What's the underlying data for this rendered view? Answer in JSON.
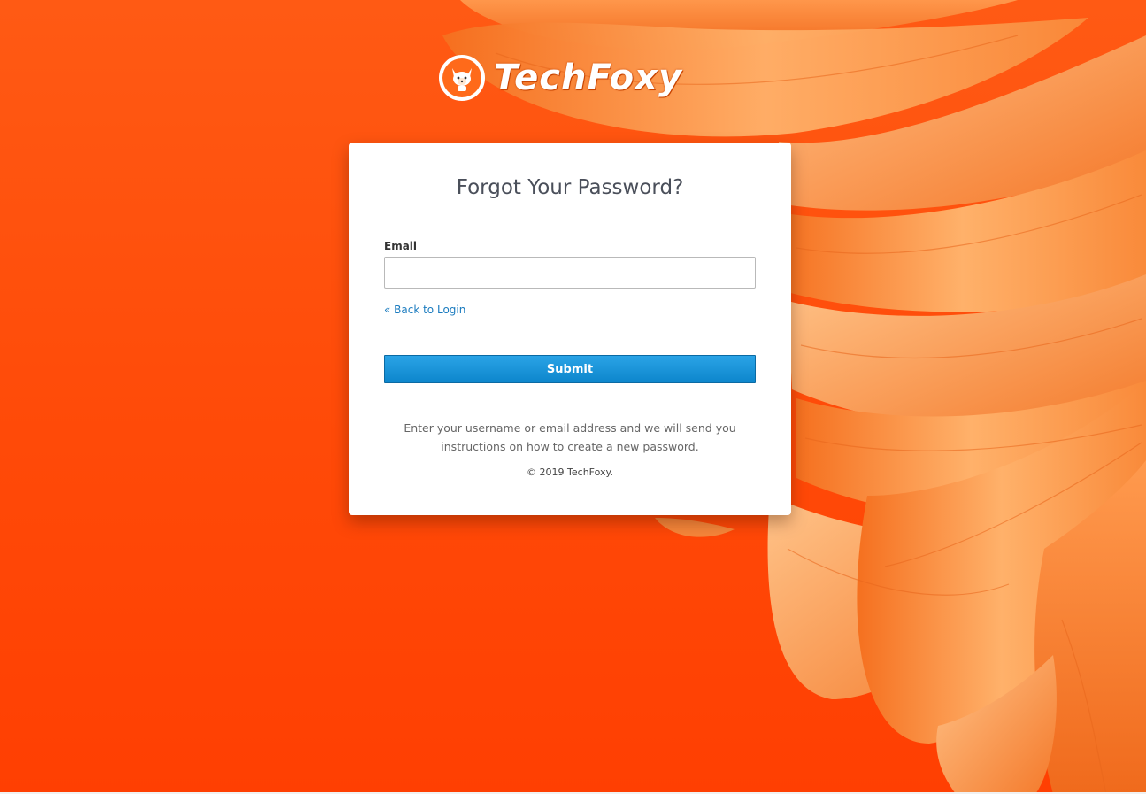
{
  "brand": {
    "name": "TechFoxy",
    "logo_icon": "fox-mascot-icon",
    "accent_color": "#ff4a0a"
  },
  "form": {
    "title": "Forgot Your Password?",
    "email_label": "Email",
    "email_value": "",
    "email_placeholder": "",
    "back_link": "« Back to Login",
    "submit_label": "Submit",
    "submit_color": "#1a91d8",
    "info_text": "Enter your username or email address and we will send you instructions on how to create a new password.",
    "copyright": "© 2019 TechFoxy."
  }
}
